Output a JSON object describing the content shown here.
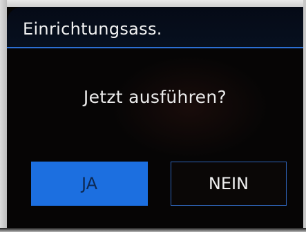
{
  "dialog": {
    "title": "Einrichtungsass.",
    "question": "Jetzt ausführen?",
    "yes_label": "JA",
    "no_label": "NEIN"
  },
  "colors": {
    "accent": "#1c6fe0",
    "title_rule": "#2b6fd4",
    "background": "#060505"
  }
}
